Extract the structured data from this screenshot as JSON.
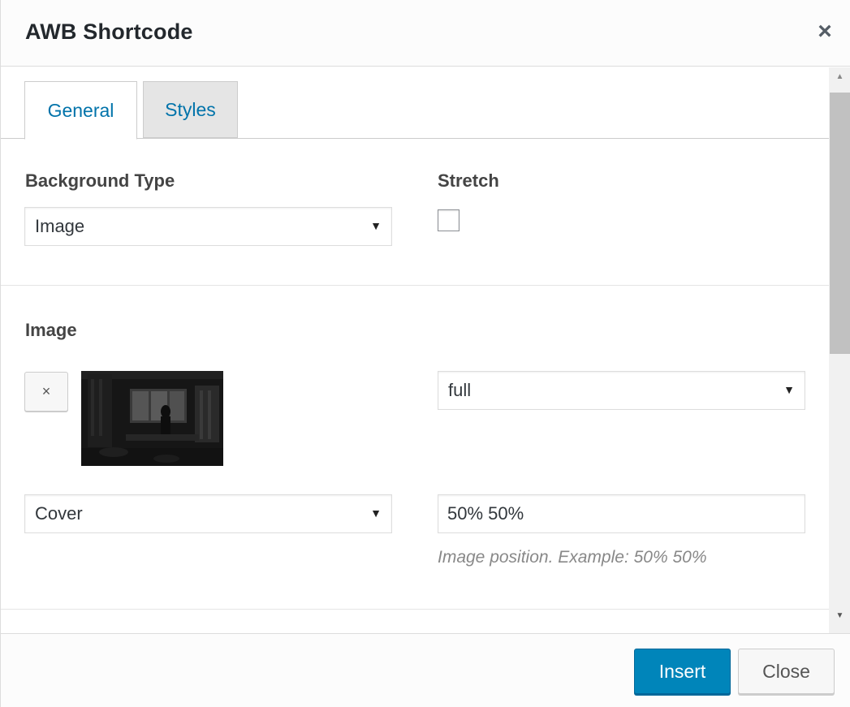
{
  "dialog": {
    "title": "AWB Shortcode",
    "close_icon": "×"
  },
  "tabs": [
    {
      "label": "General",
      "active": true
    },
    {
      "label": "Styles",
      "active": false
    }
  ],
  "general": {
    "background_type_label": "Background Type",
    "background_type_value": "Image",
    "stretch_label": "Stretch",
    "stretch_checked": false,
    "image_label": "Image",
    "remove_symbol": "×",
    "image_size_value": "full",
    "image_bg_size_value": "Cover",
    "image_position_value": "50% 50%",
    "image_position_hint": "Image position. Example: 50% 50%"
  },
  "footer": {
    "insert_label": "Insert",
    "close_label": "Close"
  },
  "icons": {
    "select_arrow": "▼",
    "scroll_up": "▲",
    "scroll_down": "▼"
  },
  "colors": {
    "accent": "#0073aa",
    "primary_button": "#0085ba"
  }
}
